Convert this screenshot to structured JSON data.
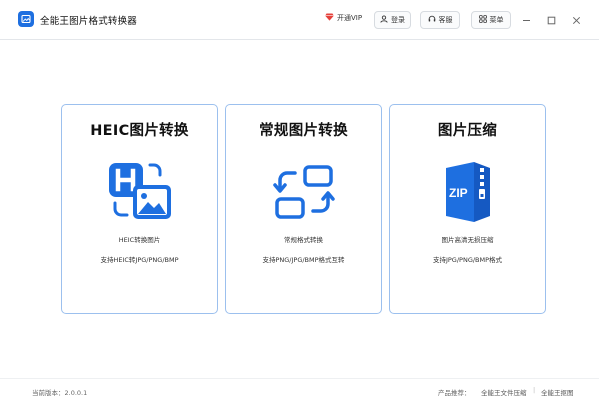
{
  "window": {
    "title": "全能王图片格式转换器",
    "vip_label": "开通VIP",
    "login_label": "登录",
    "service_label": "客服",
    "menu_label": "菜单",
    "controls": {
      "minimize": "—",
      "maximize": "☐",
      "close": "✕"
    }
  },
  "colors": {
    "accent": "#1e6fe0",
    "card_border": "#9cc0ee",
    "vip": "#e5413b"
  },
  "cards": [
    {
      "title": "HEIC图片转换",
      "line1": "HEIC转换图片",
      "line2": "支持HEIC转JPG/PNG/BMP",
      "icon": "heic-image-icon"
    },
    {
      "title": "常规图片转换",
      "line1": "常规格式转换",
      "line2": "支持PNG/JPG/BMP格式互转",
      "icon": "convert-arrows-icon"
    },
    {
      "title": "图片压缩",
      "line1": "图片高清无损压缩",
      "line2": "支持JPG/PNG/BMP格式",
      "icon": "zip-file-icon"
    }
  ],
  "footer": {
    "version": "当前版本：2.0.0.1",
    "recommend": "产品推荐：",
    "link1": "全能王文件压缩",
    "separator": "|",
    "link2": "全能王抠图"
  }
}
